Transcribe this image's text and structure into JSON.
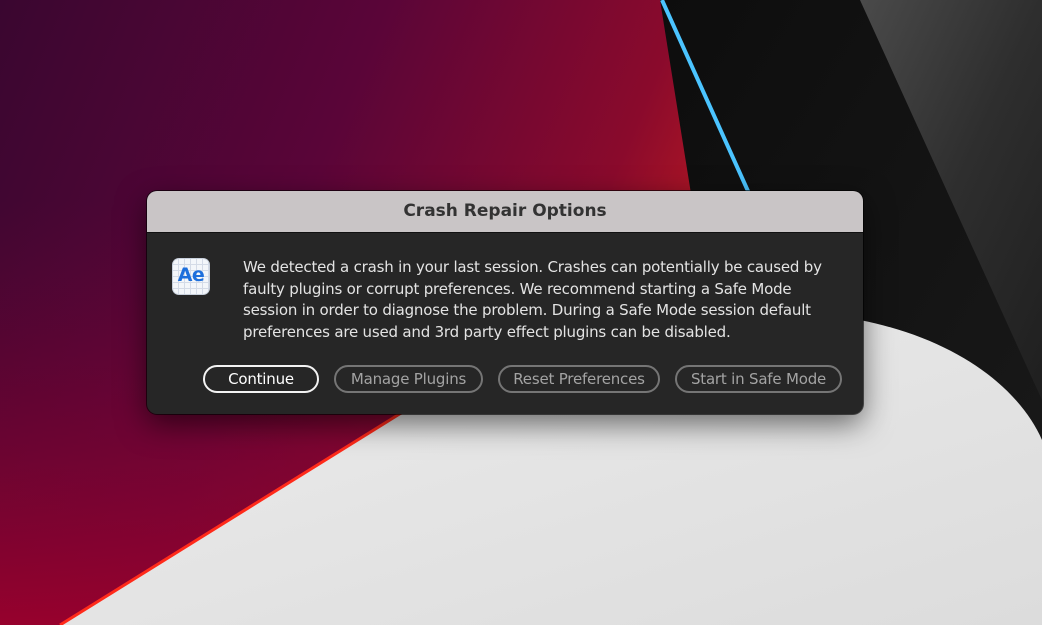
{
  "dialog": {
    "title": "Crash Repair Options",
    "app_icon_label": "Ae",
    "message": "We detected a crash in your last session. Crashes can potentially be caused by faulty plugins or corrupt preferences. We recommend starting a Safe Mode session in order to diagnose the problem. During a Safe Mode session default preferences are used and 3rd party effect plugins can be disabled.",
    "buttons": {
      "continue": "Continue",
      "manage_plugins": "Manage Plugins",
      "reset_preferences": "Reset Preferences",
      "safe_mode": "Start in Safe Mode"
    }
  },
  "colors": {
    "dialog_background": "#262626",
    "titlebar": "#c9c5c6",
    "app_icon_accent": "#1d6fdc"
  }
}
